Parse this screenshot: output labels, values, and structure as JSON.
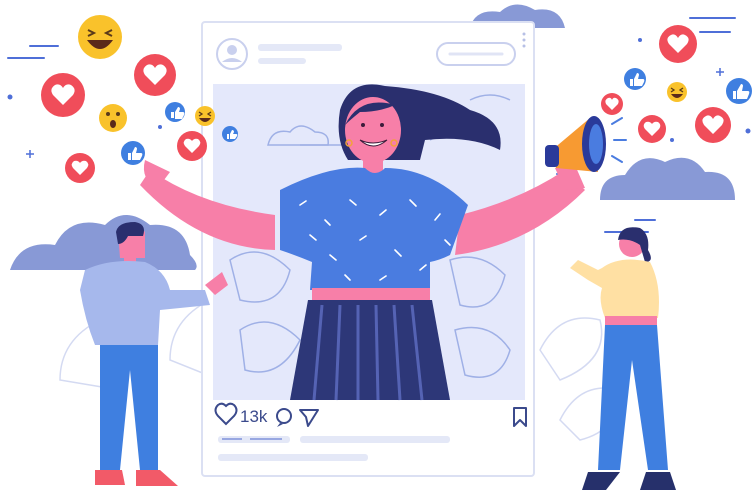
{
  "post": {
    "like_count": "13k"
  },
  "icons": {
    "post_avatar": "user-avatar-icon",
    "post_menu": "more-vertical-icon",
    "like": "heart-icon",
    "comment": "comment-icon",
    "share": "send-icon",
    "save": "bookmark-icon",
    "megaphone": "megaphone-icon",
    "reactions": [
      "heart-reaction-icon",
      "thumbs-up-reaction-icon",
      "laughing-emoji-icon",
      "surprised-emoji-icon"
    ]
  },
  "colors": {
    "primary_blue": "#4f6fd8",
    "light_blue": "#e7ebfb",
    "heart_red": "#f04d5a",
    "emoji_yellow": "#f9c22b",
    "pink_skin": "#f77fa8",
    "megaphone_orange": "#f79a32",
    "navy": "#26306b"
  }
}
